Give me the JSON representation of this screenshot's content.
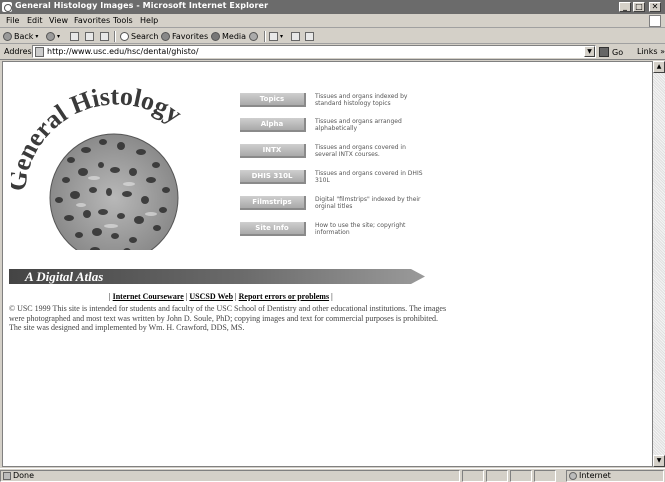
{
  "window": {
    "title": "General Histology Images - Microsoft Internet Explorer",
    "buttons": {
      "minimize": "_",
      "maximize": "□",
      "close": "✕"
    }
  },
  "menu": [
    {
      "label": "File"
    },
    {
      "label": "Edit"
    },
    {
      "label": "View"
    },
    {
      "label": "Favorites"
    },
    {
      "label": "Tools"
    },
    {
      "label": "Help"
    }
  ],
  "toolbar": {
    "back": "Back",
    "search": "Search",
    "favorites": "Favorites",
    "media": "Media"
  },
  "address": {
    "label": "Address",
    "url": "http://www.usc.edu/hsc/dental/ghisto/",
    "go": "Go",
    "links": "Links"
  },
  "page": {
    "logo": {
      "line": "General Histology"
    },
    "nav": [
      {
        "label": "Topics",
        "desc": "Tissues and organs indexed by standard histology topics"
      },
      {
        "label": "Alpha",
        "desc": "Tissues and organs arranged alphabetically"
      },
      {
        "label": "INTX",
        "desc": "Tissues and organs covered in several INTX courses."
      },
      {
        "label": "DHIS 310L",
        "desc": "Tissues and organs covered in DHIS 310L"
      },
      {
        "label": "Filmstrips",
        "desc": "Digital \"filmstrips\" indexed by their orginal titles"
      },
      {
        "label": "Site Info",
        "desc": "How to use the site; copyright information"
      }
    ],
    "banner": "A Digital Atlas",
    "links": {
      "courseware": "Internet Courseware",
      "uscsd": "USCSD Web",
      "report": "Report errors or problems"
    },
    "copyright": "© USC 1999  This site is intended for students and faculty of the USC School of Dentistry and other educational institutions. The images were photographed and most text was written by John D. Soule, PhD; copying images and text for commercial purposes is prohibited. The site was designed and implemented by Wm. H. Crawford, DDS, MS."
  },
  "status": {
    "text": "Done",
    "zone": "Internet"
  },
  "colors": {
    "titlebar": "#6b6b6b",
    "chrome": "#d4d0c8",
    "banner_dark": "#555555"
  }
}
